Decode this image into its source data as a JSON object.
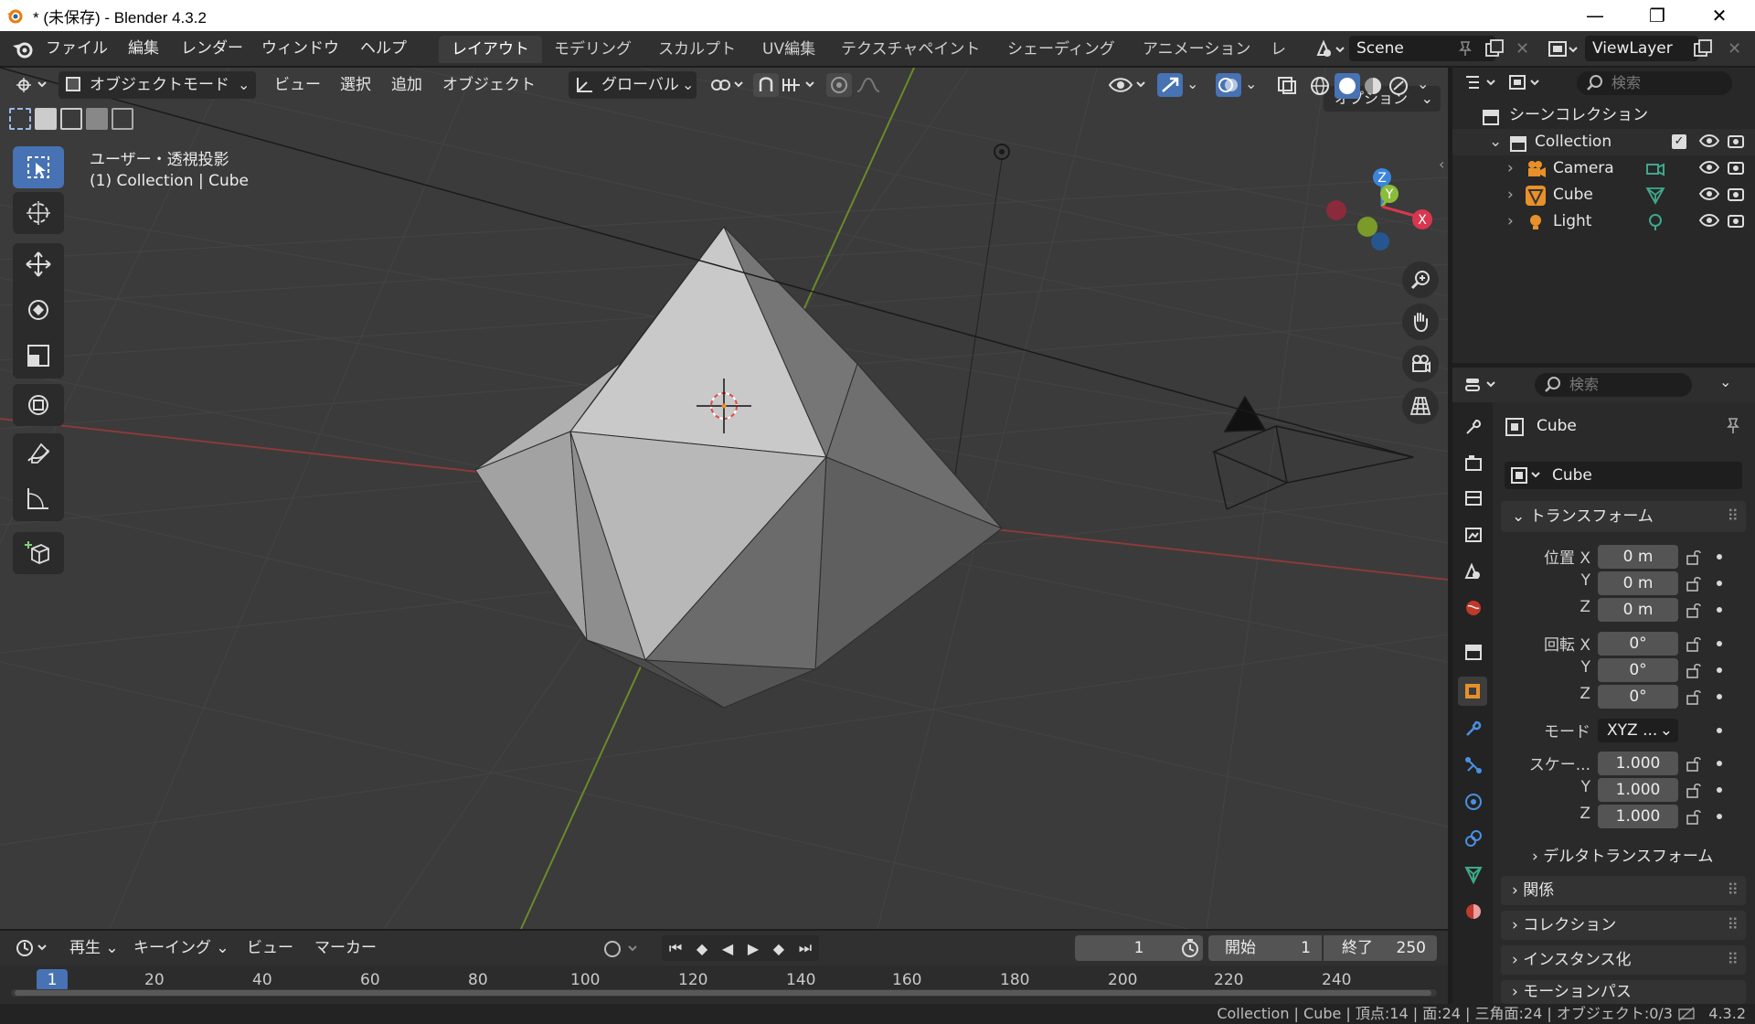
{
  "window": {
    "title": "* (未保存) - Blender 4.3.2",
    "minimize": "—",
    "maximize": "❐",
    "close": "✕"
  },
  "menu": {
    "items": [
      "ファイル",
      "編集",
      "レンダー",
      "ウィンドウ",
      "ヘルプ"
    ],
    "workspaces": [
      "レイアウト",
      "モデリング",
      "スカルプト",
      "UV編集",
      "テクスチャペイント",
      "シェーディング",
      "アニメーション",
      "レ"
    ],
    "scene": "Scene",
    "view_layer": "ViewLayer"
  },
  "viewport_header": {
    "mode": "オブジェクトモード",
    "view": "ビュー",
    "select": "選択",
    "add": "追加",
    "object": "オブジェクト",
    "orientation": "グローバル",
    "options": "オプション"
  },
  "viewport_overlay": {
    "view_name": "ユーザー・透視投影",
    "context": "(1) Collection | Cube"
  },
  "gizmo": {
    "z": "Z",
    "y": "Y",
    "x": "X"
  },
  "outliner": {
    "search_placeholder": "検索",
    "scene_collection": "シーンコレクション",
    "collection": "Collection",
    "objects": [
      "Camera",
      "Cube",
      "Light"
    ]
  },
  "properties": {
    "search_placeholder": "検索",
    "object_name": "Cube",
    "object_field": "Cube",
    "transform_title": "トランスフォーム",
    "location_label": "位置 X",
    "rotation_label": "回転 X",
    "mode_label": "モード",
    "scale_label": "スケー...",
    "axis_y": "Y",
    "axis_z": "Z",
    "location": [
      "0 m",
      "0 m",
      "0 m"
    ],
    "rotation": [
      "0°",
      "0°",
      "0°"
    ],
    "rotation_mode": "XYZ ...",
    "scale": [
      "1.000",
      "1.000",
      "1.000"
    ],
    "panels": [
      "デルタトランスフォーム",
      "関係",
      "コレクション",
      "インスタンス化",
      "モーションパス"
    ]
  },
  "timeline": {
    "playback": "再生",
    "keying": "キーイング",
    "view": "ビュー",
    "marker": "マーカー",
    "current_frame": "1",
    "start_label": "開始",
    "start": "1",
    "end_label": "終了",
    "end": "250",
    "ruler": [
      "1",
      "20",
      "40",
      "60",
      "80",
      "100",
      "120",
      "140",
      "160",
      "180",
      "200",
      "220",
      "240"
    ]
  },
  "status": {
    "text": "Collection | Cube | 頂点:14 | 面:24 | 三角面:24 | オブジェクト:0/3",
    "version": "4.3.2"
  },
  "colors": {
    "accent": "#4772b3",
    "axis_x": "#d8374f",
    "axis_y": "#8cbc3a",
    "axis_z": "#3b86db",
    "viewport_bg": "#3b3b3b"
  }
}
